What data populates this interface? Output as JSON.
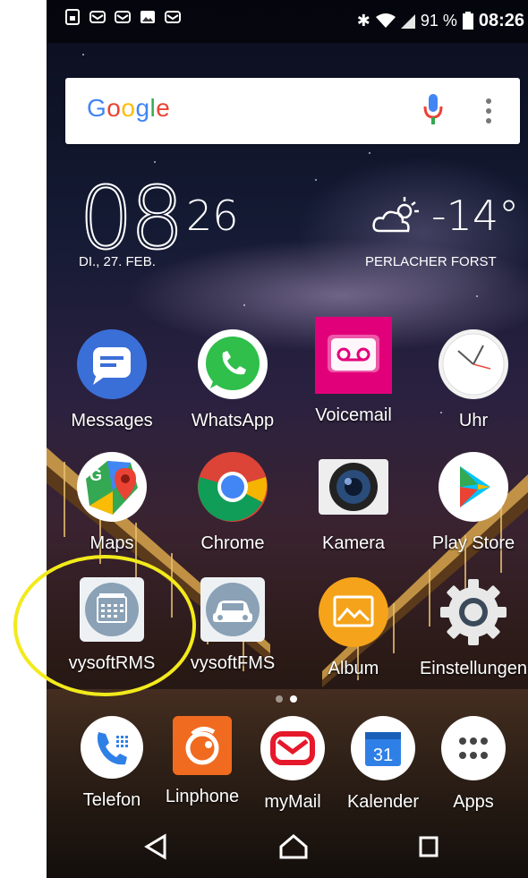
{
  "status_bar": {
    "battery": "91 %",
    "time": "08:26",
    "notification_icons": [
      "sim-icon",
      "mail-icon",
      "mail-icon",
      "image-icon",
      "mail-icon"
    ],
    "system_icons": [
      "bluetooth-icon",
      "wifi-icon",
      "signal-icon",
      "battery-icon"
    ]
  },
  "search": {
    "logo": "Google"
  },
  "clock": {
    "hour": "08",
    "minute": "26",
    "date": "DI., 27. FEB."
  },
  "weather": {
    "temperature": "-14°",
    "location": "PERLACHER FORST",
    "icon": "partly-cloudy-icon"
  },
  "apps": [
    {
      "label": "Messages",
      "icon": "messages-icon"
    },
    {
      "label": "WhatsApp",
      "icon": "whatsapp-icon"
    },
    {
      "label": "Voicemail",
      "icon": "voicemail-icon"
    },
    {
      "label": "Uhr",
      "icon": "clock-icon"
    },
    {
      "label": "Maps",
      "icon": "maps-icon"
    },
    {
      "label": "Chrome",
      "icon": "chrome-icon"
    },
    {
      "label": "Kamera",
      "icon": "camera-icon"
    },
    {
      "label": "Play Store",
      "icon": "play-store-icon"
    },
    {
      "label": "vysoftRMS",
      "icon": "calendar-grid-icon"
    },
    {
      "label": "vysoftFMS",
      "icon": "car-icon"
    },
    {
      "label": "Album",
      "icon": "album-icon"
    },
    {
      "label": "Einstellungen",
      "icon": "settings-gear-icon"
    }
  ],
  "dock": [
    {
      "label": "Telefon",
      "icon": "phone-icon"
    },
    {
      "label": "Linphone",
      "icon": "linphone-icon"
    },
    {
      "label": "myMail",
      "icon": "mymail-icon"
    },
    {
      "label": "Kalender",
      "icon": "calendar-icon",
      "badge": "31"
    },
    {
      "label": "Apps",
      "icon": "app-drawer-icon"
    }
  ],
  "navigation": [
    "back-icon",
    "home-icon",
    "recents-icon"
  ],
  "colors": {
    "highlight": "#f2ea1b",
    "messages": "#3b6fd8",
    "whatsapp": "#2fbf4a",
    "voicemail": "#e2007a",
    "album": "#f5a31a",
    "linphone": "#f06b1f",
    "mymail": "#e5192b",
    "kalender": "#2f80e6"
  }
}
